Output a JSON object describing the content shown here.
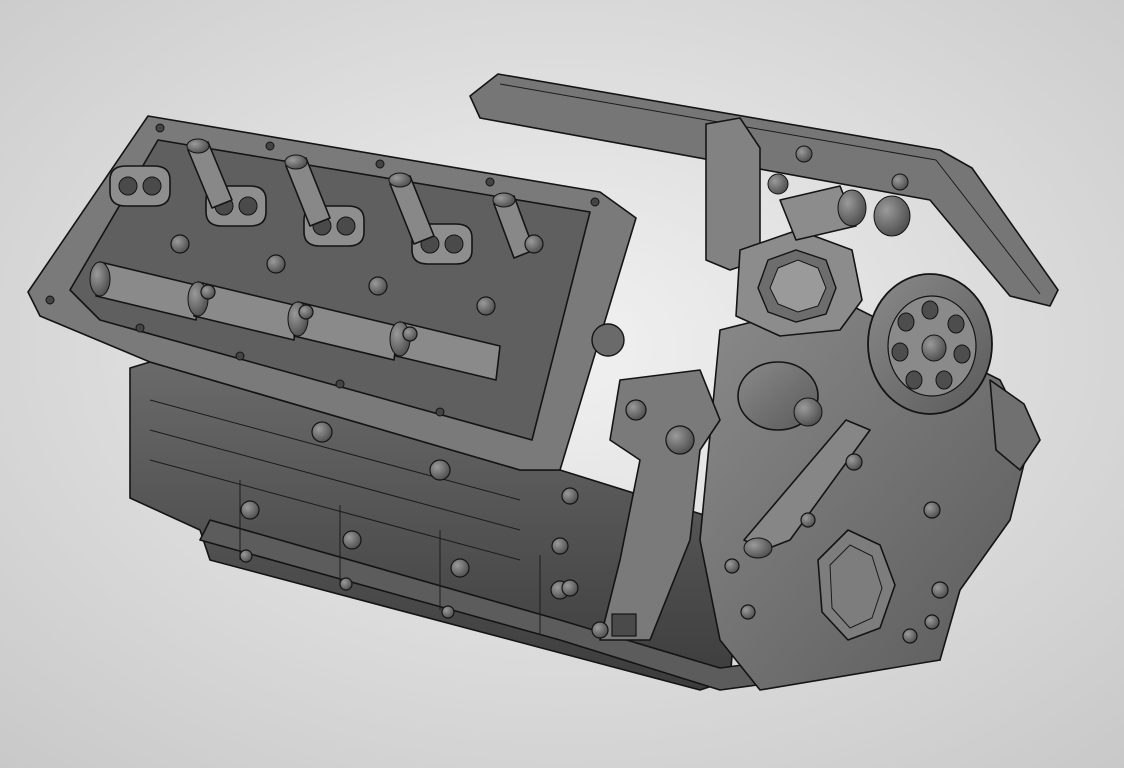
{
  "viewport": {
    "background": {
      "center_color": "#f1f1f1",
      "edge_color": "#c8c8c8"
    },
    "model": {
      "subject": "engine-block",
      "body_color": "#6c6c6c",
      "light_color": "#8d8d8d",
      "dark_color": "#3f3f3f",
      "edge_color": "#141414"
    }
  }
}
